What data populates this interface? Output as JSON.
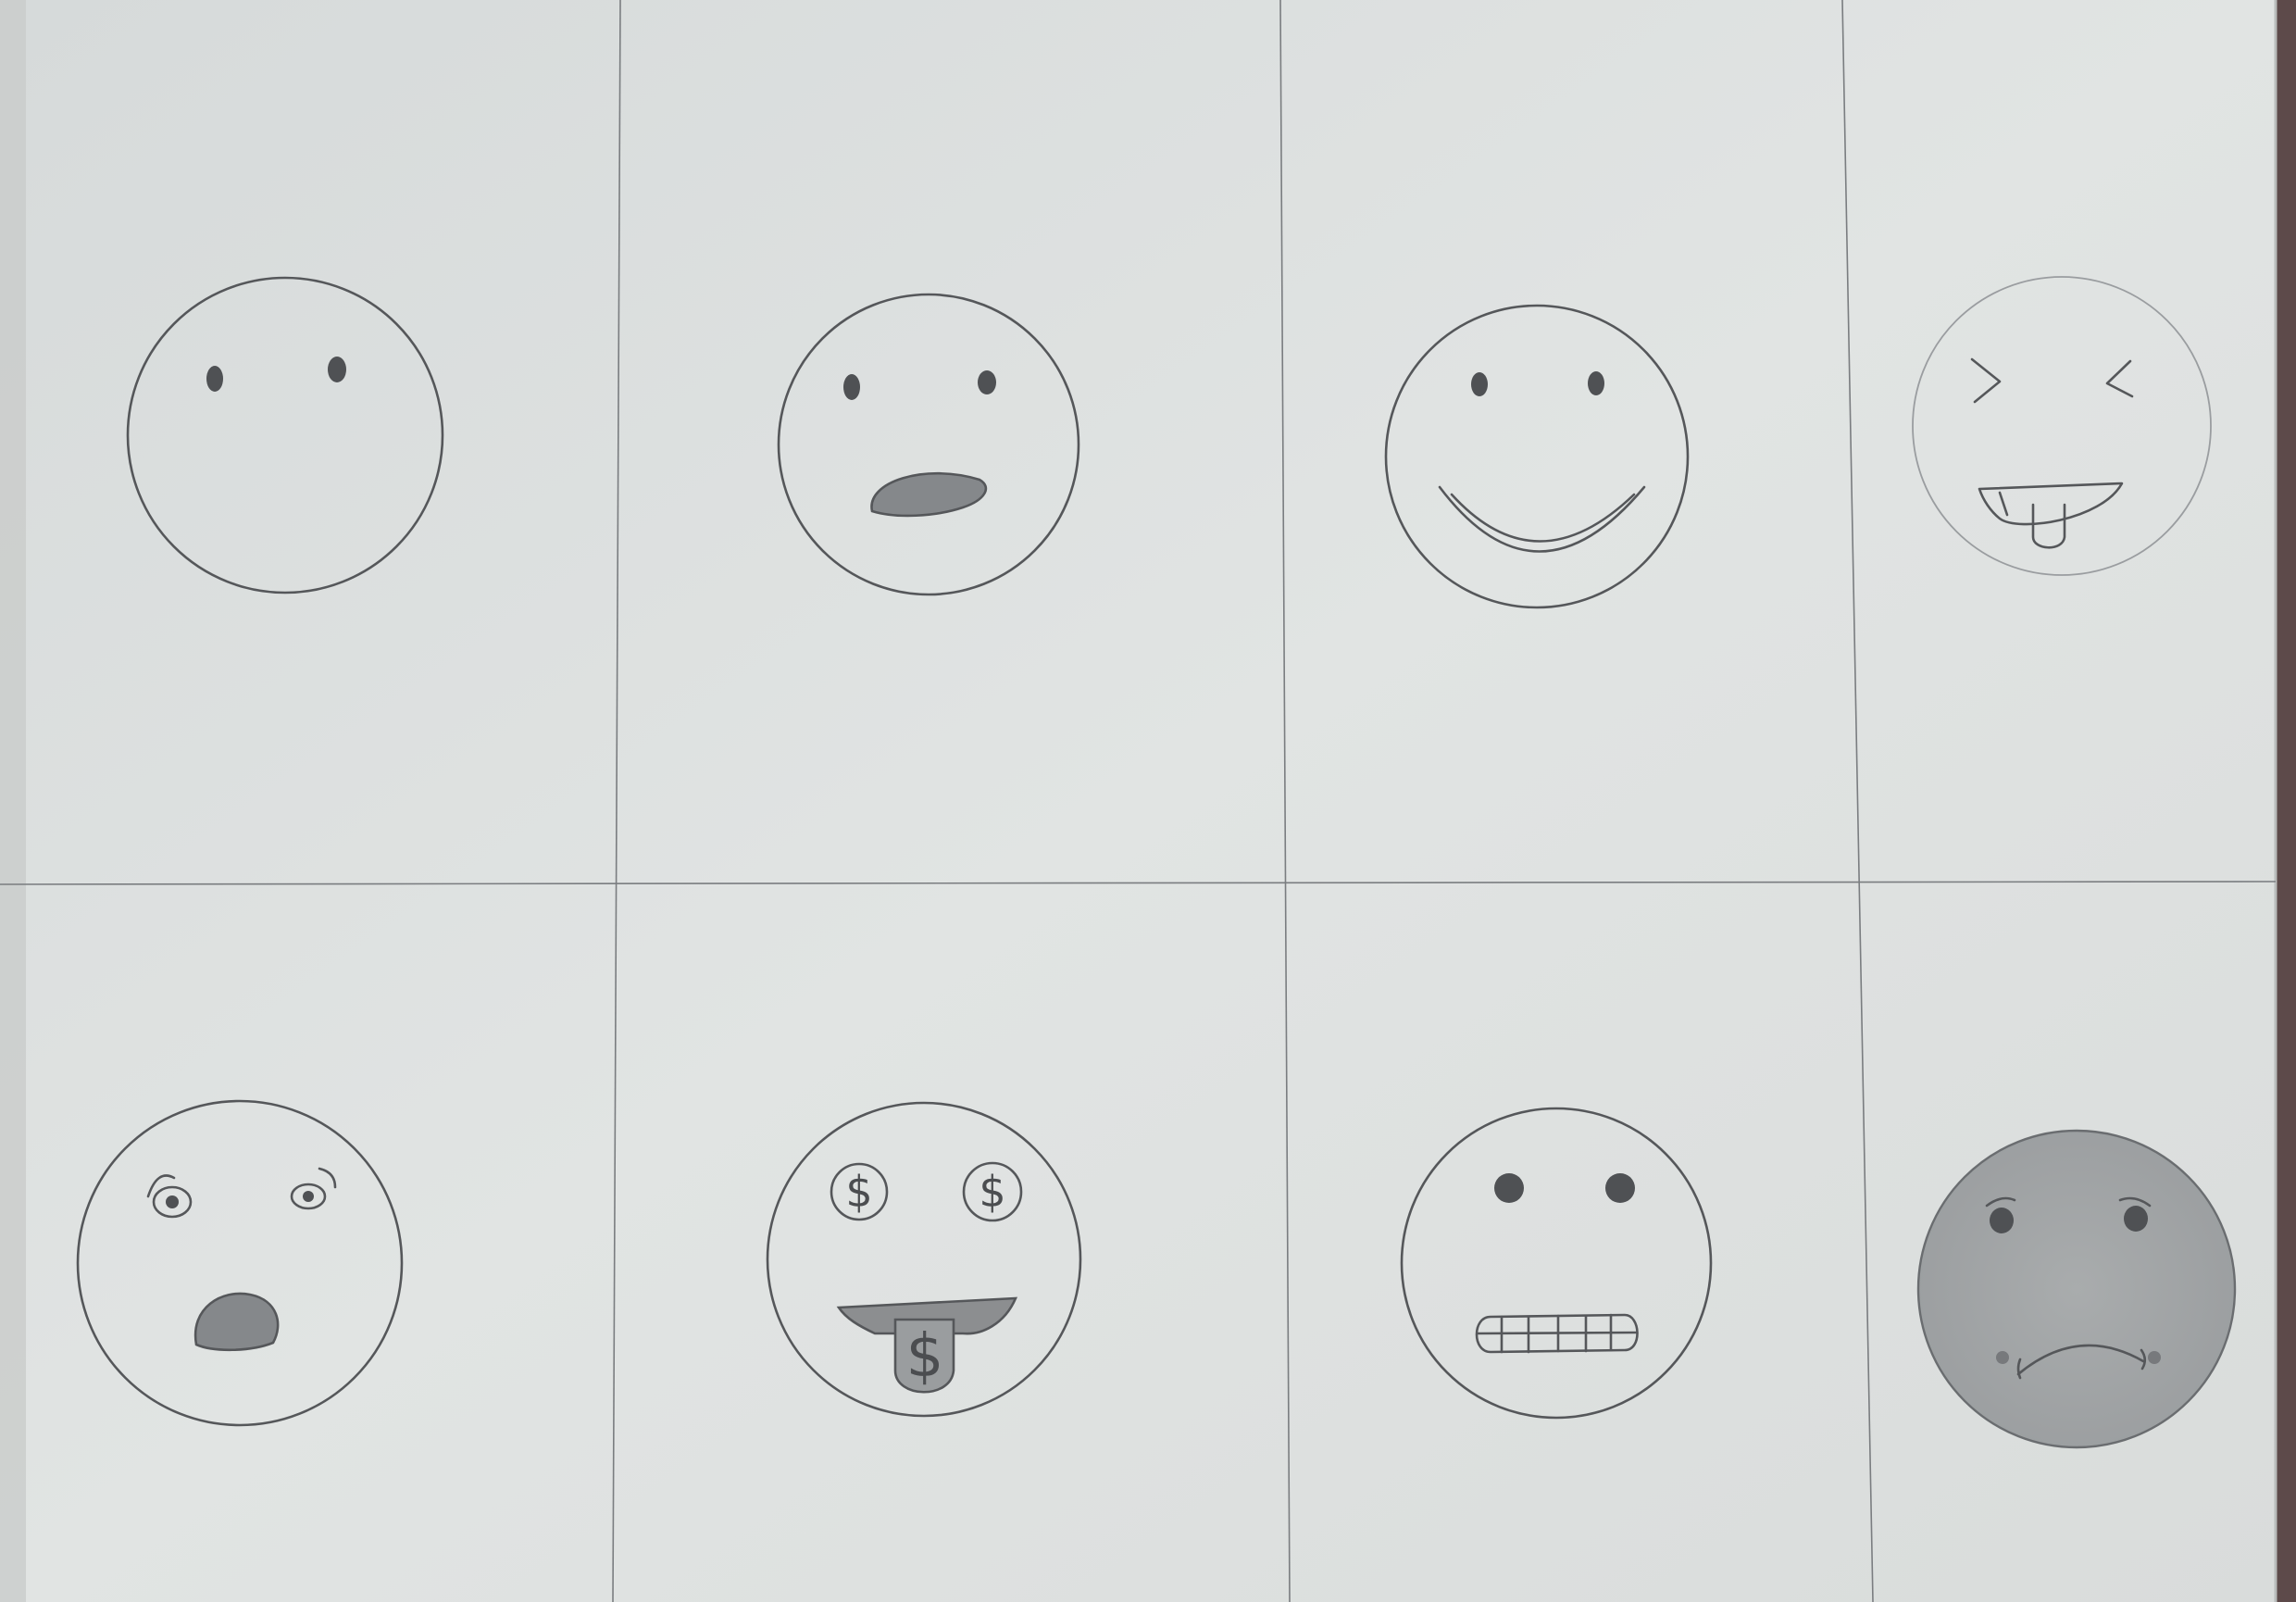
{
  "sheet": {
    "colors": {
      "paper": "#dde0e0",
      "pencil": "#55575a",
      "shading": "#8c8e90",
      "background": "#8e8a86"
    }
  },
  "faces": [
    {
      "position": "row-1-col-1",
      "expression": "blank",
      "mouth": "none"
    },
    {
      "position": "row-1-col-2",
      "expression": "open-mouth",
      "mouth": "shaded-oval"
    },
    {
      "position": "row-1-col-3",
      "expression": "smiling",
      "mouth": "wide-smile"
    },
    {
      "position": "row-1-col-4",
      "expression": "squinting-tongue-out",
      "eyes": "angle-brackets"
    },
    {
      "position": "row-2-col-1",
      "expression": "surprised",
      "mouth": "shaded-open"
    },
    {
      "position": "row-2-col-2",
      "expression": "money-mouth",
      "eye_symbol": "$",
      "tongue_symbol": "$"
    },
    {
      "position": "row-2-col-3",
      "expression": "grimacing",
      "mouth": "teeth-grid"
    },
    {
      "position": "row-2-col-4",
      "expression": "sad-worried",
      "fill": "shaded"
    }
  ]
}
